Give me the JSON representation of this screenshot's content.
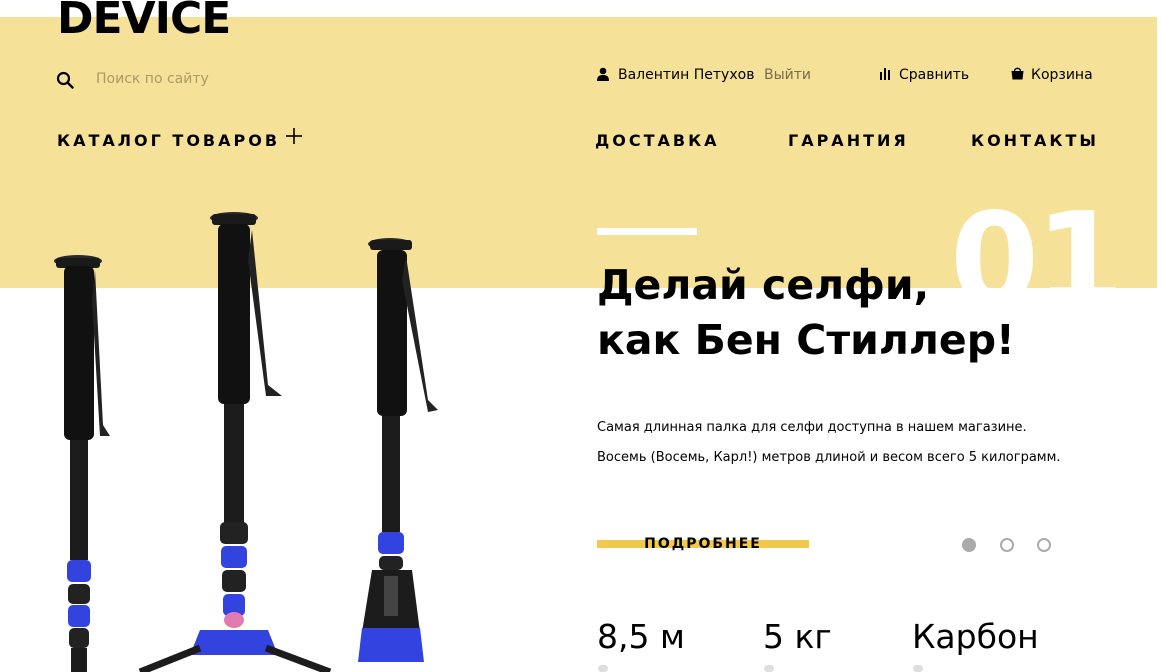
{
  "header": {
    "logo": "DEVICE",
    "search": {
      "placeholder": "Поиск по сайту",
      "value": ""
    },
    "user": {
      "name": "Валентин Петухов",
      "logout": "Выйти"
    },
    "compare": "Сравнить",
    "cart": "Корзина",
    "catalog": "КАТАЛОГ ТОВАРОВ",
    "nav": [
      "ДОСТАВКА",
      "ГАРАНТИЯ",
      "КОНТАКТЫ"
    ]
  },
  "slide": {
    "number": "01",
    "title_line1": "Делай селфи,",
    "title_line2": "как Бен Стиллер!",
    "desc_line1": "Самая длинная палка для селфи доступна в нашем магазине.",
    "desc_line2": "Восемь (Восемь, Карл!) метров длиной и весом всего 5 килограмм.",
    "more_button": "ПОДРОБНЕЕ",
    "pagination": {
      "total": 3,
      "active": 1
    }
  },
  "specs": [
    "8,5 м",
    "5 кг",
    "Карбон"
  ],
  "colors": {
    "band": "#f6e199",
    "accent": "#f2c94c",
    "blue_parts": "#3243e0"
  },
  "icons": [
    "search-icon",
    "user-icon",
    "compare-icon",
    "cart-icon",
    "plus-icon"
  ]
}
